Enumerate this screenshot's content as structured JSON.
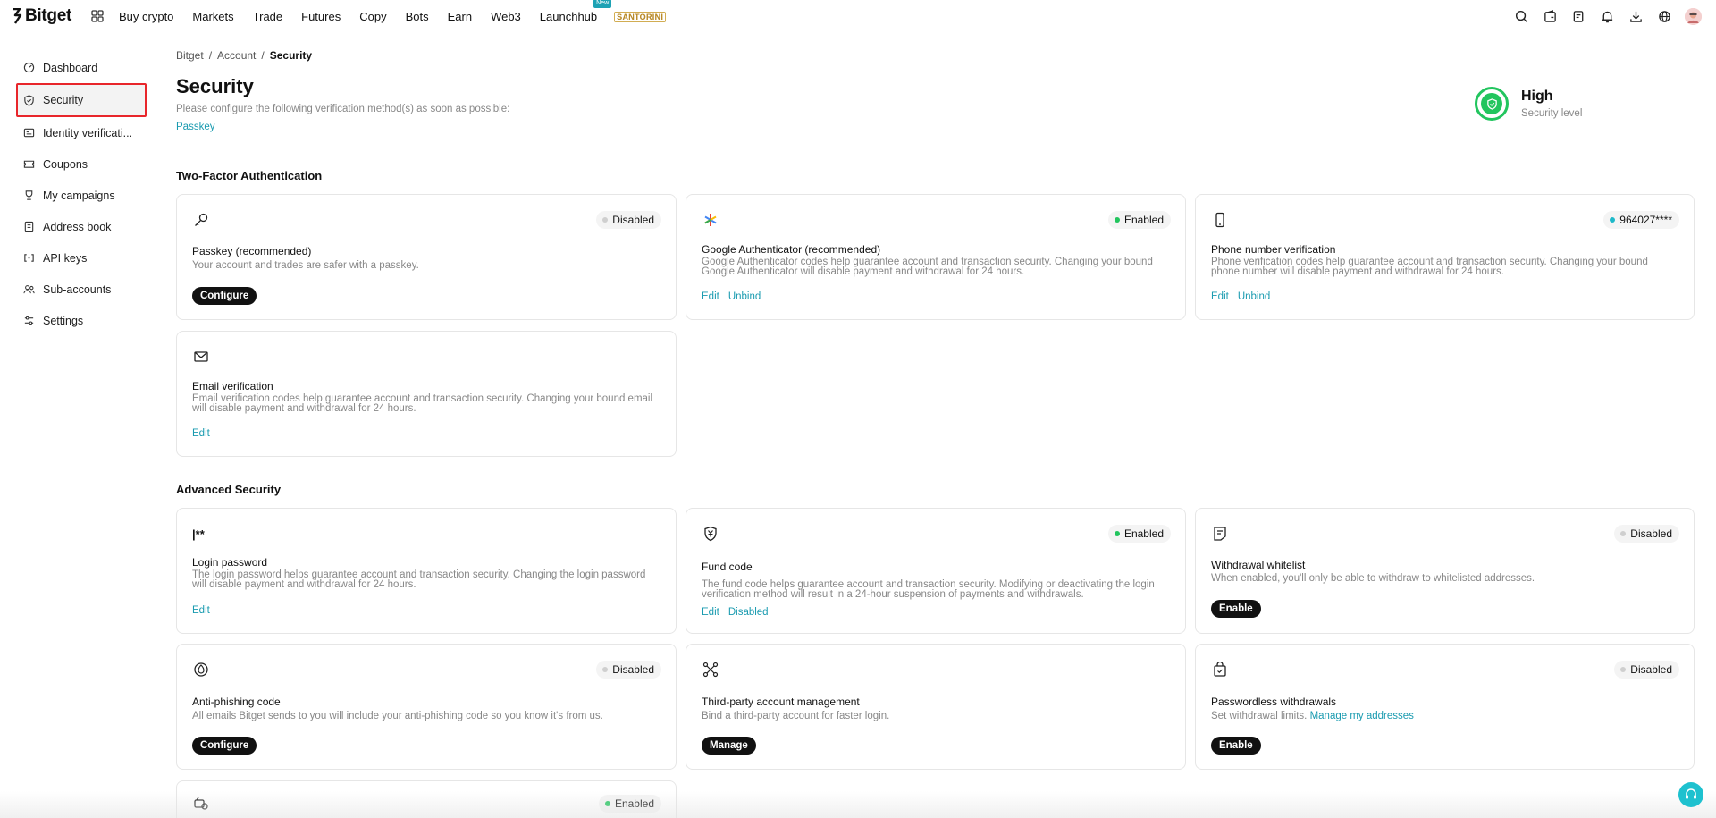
{
  "brand": {
    "name": "Bitget"
  },
  "nav": {
    "items": [
      "Buy crypto",
      "Markets",
      "Trade",
      "Futures",
      "Copy",
      "Bots",
      "Earn",
      "Web3",
      "Launchhub"
    ],
    "new_badge": "New",
    "promo_label": "SANTORINI"
  },
  "sidebar": {
    "items": [
      {
        "label": "Dashboard",
        "icon": "dashboard-icon"
      },
      {
        "label": "Security",
        "icon": "shield-icon",
        "active": true
      },
      {
        "label": "Identity verificati...",
        "icon": "id-card-icon"
      },
      {
        "label": "Coupons",
        "icon": "coupon-icon"
      },
      {
        "label": "My campaigns",
        "icon": "trophy-icon"
      },
      {
        "label": "Address book",
        "icon": "book-icon"
      },
      {
        "label": "API keys",
        "icon": "api-icon"
      },
      {
        "label": "Sub-accounts",
        "icon": "users-icon"
      },
      {
        "label": "Settings",
        "icon": "settings-icon"
      }
    ]
  },
  "breadcrumb": {
    "items": [
      "Bitget",
      "Account",
      "Security"
    ],
    "sep": "/"
  },
  "page": {
    "title": "Security",
    "subtitle": "Please configure the following verification method(s) as soon as possible:",
    "link": "Passkey"
  },
  "security_level": {
    "value": "High",
    "label": "Security level"
  },
  "sections": {
    "two_factor": "Two-Factor Authentication",
    "advanced": "Advanced Security"
  },
  "cards": {
    "passkey": {
      "title": "Passkey (recommended)",
      "desc": "Your account and trades are safer with a passkey.",
      "status": "Disabled",
      "action": "Configure"
    },
    "google": {
      "title": "Google Authenticator (recommended)",
      "desc": "Google Authenticator codes help guarantee account and transaction security. Changing your bound Google Authenticator will disable payment and withdrawal for 24 hours.",
      "status": "Enabled",
      "link1": "Edit",
      "link2": "Unbind"
    },
    "phone": {
      "title": "Phone number verification",
      "desc": "Phone verification codes help guarantee account and transaction security. Changing your bound phone number will disable payment and withdrawal for 24 hours.",
      "status": "964027****",
      "link1": "Edit",
      "link2": "Unbind"
    },
    "email": {
      "title": "Email verification",
      "desc": "Email verification codes help guarantee account and transaction security. Changing your bound email will disable payment and withdrawal for 24 hours.",
      "link1": "Edit"
    },
    "login_password": {
      "title": "Login password",
      "desc": "The login password helps guarantee account and transaction security. Changing the login password will disable payment and withdrawal for 24 hours.",
      "link1": "Edit",
      "icon_text": "|**"
    },
    "fund_code": {
      "title": "Fund code",
      "desc": "The fund code helps guarantee account and transaction security. Modifying or deactivating the login verification method will result in a 24-hour suspension of payments and withdrawals.",
      "status": "Enabled",
      "link1": "Edit",
      "link2": "Disabled"
    },
    "whitelist": {
      "title": "Withdrawal whitelist",
      "desc": "When enabled, you'll only be able to withdraw to whitelisted addresses.",
      "status": "Disabled",
      "action": "Enable"
    },
    "anti_phishing": {
      "title": "Anti-phishing code",
      "desc": "All emails Bitget sends to you will include your anti-phishing code so you know it's from us.",
      "status": "Disabled",
      "action": "Configure"
    },
    "third_party": {
      "title": "Third-party account management",
      "desc": "Bind a third-party account for faster login.",
      "action": "Manage"
    },
    "passwordless": {
      "title": "Passwordless withdrawals",
      "desc": "Set withdrawal limits.",
      "desc_link": "Manage my addresses",
      "status": "Disabled",
      "action": "Enable"
    },
    "device": {
      "status": "Enabled"
    }
  },
  "colors": {
    "accent": "#1a9bb0",
    "enabled": "#22c55e",
    "highlight": "#e8262b"
  }
}
